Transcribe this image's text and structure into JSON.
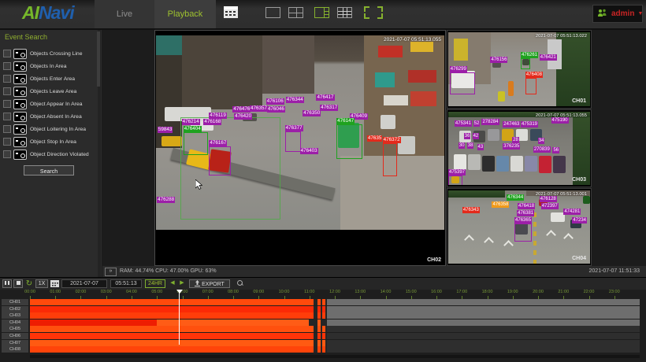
{
  "topbar": {
    "logo": {
      "ai": "AI",
      "navi": "Navi"
    },
    "tabs": [
      {
        "label": "Live"
      },
      {
        "label": "Playback"
      }
    ],
    "user": {
      "name": "admin"
    }
  },
  "icons": {
    "loop": "↻",
    "prev": "◀",
    "next": "▶",
    "dropdown": "▼",
    "expand": "»"
  },
  "sidebar": {
    "title": "Event Search",
    "search_button": "Search",
    "items": [
      "Objects Crossing Line",
      "Objects In Area",
      "Objects Enter Area",
      "Objects Leave Area",
      "Object Appear In Area",
      "Object Absent In Area",
      "Object Loitering In Area",
      "Object Stop In Area",
      "Object Direction Violated"
    ]
  },
  "colors": {
    "purple": "#9c1fa8",
    "green": "#1fa21f",
    "red": "#e32a1c",
    "orange": "#f09a1a"
  },
  "views": {
    "main": {
      "channel": "CH02",
      "timestamp": "2021-07-07 05:51:13.055",
      "detections": [
        [
          "59843",
          0.5,
          47,
          "purple",
          0,
          0
        ],
        [
          "476214",
          8.9,
          43,
          "purple",
          0,
          0
        ],
        [
          "476404",
          9.5,
          46.5,
          "green",
          8,
          11
        ],
        [
          "476119",
          18.4,
          39.5,
          "purple",
          0,
          0
        ],
        [
          "476168",
          16.5,
          43,
          "purple",
          0,
          0
        ],
        [
          "476476",
          26.6,
          36.5,
          "purple",
          0,
          0
        ],
        [
          "476420",
          27.1,
          40,
          "purple",
          0,
          0
        ],
        [
          "476357",
          32.5,
          36,
          "purple",
          0,
          0
        ],
        [
          "476046",
          38.5,
          36.5,
          "purple",
          0,
          0
        ],
        [
          "476106",
          38.2,
          32.5,
          "purple",
          0,
          0
        ],
        [
          "476344",
          45.0,
          31.5,
          "purple",
          0,
          0
        ],
        [
          "476417",
          55.6,
          30.5,
          "purple",
          0,
          0
        ],
        [
          "476317",
          56.9,
          35.5,
          "purple",
          0,
          0
        ],
        [
          "476350",
          50.9,
          38.5,
          "purple",
          0,
          0
        ],
        [
          "476377",
          44.7,
          46,
          "purple",
          5,
          10
        ],
        [
          "476409",
          67.2,
          40,
          "purple",
          0,
          0
        ],
        [
          "476147",
          62.6,
          42.5,
          "green",
          8.5,
          17
        ],
        [
          "476167",
          18.4,
          54,
          "purple",
          7,
          14
        ],
        [
          "476403",
          49.9,
          58,
          "purple",
          0,
          0
        ],
        [
          "47635",
          73.2,
          51.5,
          "red",
          0,
          0
        ],
        [
          "476372",
          78.6,
          52.3,
          "red",
          4.5,
          16
        ],
        [
          "476288",
          0.3,
          83,
          "purple",
          0,
          0
        ]
      ]
    },
    "side": [
      {
        "channel": "CH01",
        "timestamp": "2021-07-07 05:51:13.022",
        "detections": [
          [
            "476299",
            1,
            46,
            "purple",
            17,
            27
          ],
          [
            "476156",
            29.7,
            33,
            "purple",
            0,
            0
          ],
          [
            "476261",
            51.1,
            27,
            "green",
            5.5,
            12
          ],
          [
            "476421",
            64.3,
            30,
            "purple",
            0,
            0
          ],
          [
            "476408",
            54.4,
            53,
            "red",
            6.5,
            20
          ]
        ]
      },
      {
        "channel": "CH03",
        "timestamp": "2021-07-07 05:51:13.055",
        "detections": [
          [
            "475341",
            4.4,
            12,
            "purple",
            0,
            0
          ],
          [
            "52",
            17.6,
            12,
            "purple",
            0,
            0
          ],
          [
            "278284",
            23.6,
            10,
            "purple",
            0,
            0
          ],
          [
            "247463",
            38.5,
            13,
            "purple",
            0,
            0
          ],
          [
            "475319",
            51.1,
            13,
            "purple",
            0,
            0
          ],
          [
            "475190",
            72.5,
            7,
            "purple",
            0,
            0
          ],
          [
            "36",
            11,
            29,
            "purple",
            0,
            0
          ],
          [
            "42",
            17,
            29,
            "purple",
            0,
            0
          ],
          [
            "28",
            45.1,
            34,
            "purple",
            0,
            0
          ],
          [
            "34",
            63.2,
            35,
            "purple",
            0,
            0
          ],
          [
            "30",
            7.1,
            42,
            "purple",
            0,
            0
          ],
          [
            "38",
            13.2,
            42,
            "purple",
            0,
            0
          ],
          [
            "43",
            20.3,
            44,
            "purple",
            0,
            0
          ],
          [
            "376235",
            38.5,
            43,
            "purple",
            0,
            0
          ],
          [
            "270839",
            59.9,
            47,
            "purple",
            0,
            0
          ],
          [
            "56",
            73.6,
            48,
            "purple",
            0,
            0
          ],
          [
            "475397",
            0,
            78,
            "purple",
            9,
            14
          ]
        ]
      },
      {
        "channel": "CH04",
        "timestamp": "2021-07-07 05:51:13.001",
        "detections": [
          [
            "476344",
            41.2,
            5,
            "green",
            0,
            0
          ],
          [
            "476128",
            64.3,
            7,
            "purple",
            0,
            0
          ],
          [
            "476358",
            30.8,
            15,
            "orange",
            0,
            0
          ],
          [
            "476418",
            48.9,
            17,
            "purple",
            0,
            0
          ],
          [
            "472397",
            65.4,
            17,
            "purple",
            0,
            0
          ],
          [
            "476343",
            9.9,
            23,
            "red",
            0,
            0
          ],
          [
            "474281",
            81.3,
            25,
            "purple",
            0,
            0
          ],
          [
            "476381",
            48.4,
            27,
            "purple",
            0,
            0
          ],
          [
            "476365",
            46.7,
            37,
            "purple",
            11,
            22
          ],
          [
            "47234",
            87.4,
            37,
            "purple",
            0,
            0
          ]
        ]
      }
    ]
  },
  "statusbar": {
    "stats": "RAM: 44.74% CPU: 47.00% GPU: 63%",
    "datetime": "2021-07-07 11:51:33"
  },
  "playback_controls": {
    "speed": "1X",
    "date": "2021-07-07",
    "time": "05:51:13",
    "range": "24HR",
    "export": "EXPORT"
  },
  "timeline": {
    "hours": [
      "00:00",
      "01:00",
      "02:00",
      "03:00",
      "04:00",
      "05:00",
      "06:00",
      "07:00",
      "08:00",
      "09:00",
      "10:00",
      "11:00",
      "12:00",
      "13:00",
      "14:00",
      "15:00",
      "16:00",
      "17:00",
      "18:00",
      "19:00",
      "20:00",
      "21:00",
      "22:00",
      "23:00"
    ],
    "playhead_frac": 0.2441,
    "channels": [
      {
        "name": "CH01",
        "tail": "light",
        "segments": [
          [
            0,
            0.465,
            "#ff4a0c"
          ],
          [
            0.4715,
            0.4765,
            "#ff4a0c"
          ],
          [
            0.479,
            0.4845,
            "#ff4a0c"
          ]
        ]
      },
      {
        "name": "CH02",
        "tail": "light",
        "segments": [
          [
            0,
            0.465,
            "#fb2a06"
          ],
          [
            0.4715,
            0.4765,
            "#fb2a06"
          ],
          [
            0.479,
            0.4845,
            "#fb2a06"
          ]
        ]
      },
      {
        "name": "CH03",
        "tail": "light",
        "segments": [
          [
            0,
            0.465,
            "#ff3d0a"
          ],
          [
            0.4715,
            0.4765,
            "#ff3d0a"
          ],
          [
            0.479,
            0.4845,
            "#ff3d0a"
          ]
        ]
      },
      {
        "name": "CH04",
        "tail": "light",
        "segments": [
          [
            0,
            0.208,
            "#ee1d02"
          ],
          [
            0.208,
            0.458,
            "#ff5c16"
          ],
          [
            0.4715,
            0.4765,
            "#ff5c16"
          ]
        ]
      },
      {
        "name": "CH05",
        "tail": "dark",
        "segments": [
          [
            0,
            0.465,
            "#ff500e"
          ],
          [
            0.4715,
            0.4765,
            "#ff500e"
          ],
          [
            0.479,
            0.4845,
            "#ff500e"
          ]
        ]
      },
      {
        "name": "CH06",
        "tail": "dark",
        "segments": [
          [
            0,
            0.465,
            "#ff3408"
          ],
          [
            0.4715,
            0.4765,
            "#ff3408"
          ],
          [
            0.479,
            0.4845,
            "#ff3408"
          ]
        ]
      },
      {
        "name": "CH07",
        "tail": "dark",
        "segments": [
          [
            0,
            0.465,
            "#ff5a12"
          ],
          [
            0.4715,
            0.4765,
            "#ff5a12"
          ],
          [
            0.479,
            0.4845,
            "#ff5a12"
          ]
        ]
      },
      {
        "name": "CH08",
        "tail": "dark",
        "segments": [
          [
            0,
            0.465,
            "#ff440a"
          ],
          [
            0.4715,
            0.4765,
            "#ff440a"
          ],
          [
            0.479,
            0.4845,
            "#ff440a"
          ]
        ]
      }
    ]
  }
}
